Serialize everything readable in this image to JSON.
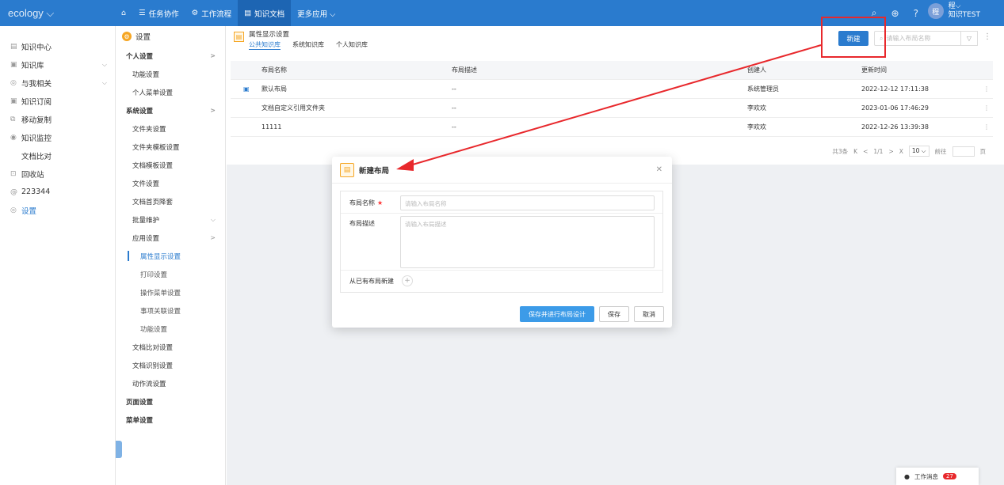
{
  "topbar": {
    "brand": "ecology ⌵",
    "home_icon": "home-icon",
    "nav": [
      {
        "icon": "☰",
        "label": "任务协作"
      },
      {
        "icon": "⚙",
        "label": "工作流程"
      },
      {
        "icon": "▤",
        "label": "知识文档"
      },
      {
        "icon": "",
        "label": "更多应用 ⌵"
      }
    ],
    "user_avatar": "程",
    "user_name": "程⌵",
    "user_sub": "知识TEST"
  },
  "leftnav": [
    {
      "icon": "▤",
      "label": "知识中心",
      "chev": ""
    },
    {
      "icon": "▣",
      "label": "知识库",
      "chev": "⌵"
    },
    {
      "icon": "◎",
      "label": "与我相关",
      "chev": "⌵"
    },
    {
      "icon": "▣",
      "label": "知识订阅",
      "chev": ""
    },
    {
      "icon": "⧉",
      "label": "移动复制",
      "chev": ""
    },
    {
      "icon": "◉",
      "label": "知识监控",
      "chev": ""
    },
    {
      "icon": "",
      "label": "文档比对",
      "chev": ""
    },
    {
      "icon": "⊡",
      "label": "回收站",
      "chev": ""
    },
    {
      "icon": "@",
      "label": "223344",
      "chev": ""
    },
    {
      "icon": "◎",
      "label": "设置",
      "chev": ""
    }
  ],
  "subnav": {
    "title": "设置",
    "items": [
      {
        "level": 0,
        "label": "个人设置",
        "chev": ">"
      },
      {
        "level": 1,
        "label": "功能设置",
        "chev": ""
      },
      {
        "level": 1,
        "label": "个人菜单设置",
        "chev": ""
      },
      {
        "level": 0,
        "label": "系统设置",
        "chev": ">"
      },
      {
        "level": 1,
        "label": "文件夹设置",
        "chev": ""
      },
      {
        "level": 1,
        "label": "文件夹模板设置",
        "chev": ""
      },
      {
        "level": 1,
        "label": "文档模板设置",
        "chev": ""
      },
      {
        "level": 1,
        "label": "文件设置",
        "chev": ""
      },
      {
        "level": 1,
        "label": "文档首页降套",
        "chev": ""
      },
      {
        "level": 1,
        "label": "批量维护",
        "chev": "⌵"
      },
      {
        "level": 1,
        "label": "应用设置",
        "chev": ">"
      },
      {
        "level": 2,
        "label": "属性显示设置",
        "chev": "",
        "active": true
      },
      {
        "level": 2,
        "label": "打印设置",
        "chev": ""
      },
      {
        "level": 2,
        "label": "操作菜单设置",
        "chev": ""
      },
      {
        "level": 2,
        "label": "事项关联设置",
        "chev": ""
      },
      {
        "level": 2,
        "label": "功能设置",
        "chev": ""
      },
      {
        "level": 1,
        "label": "文档比对设置",
        "chev": ""
      },
      {
        "level": 1,
        "label": "文档识别设置",
        "chev": ""
      },
      {
        "level": 1,
        "label": "动作流设置",
        "chev": ""
      },
      {
        "level": 0,
        "label": "页面设置",
        "chev": ""
      },
      {
        "level": 0,
        "label": "菜单设置",
        "chev": ""
      }
    ]
  },
  "page": {
    "title": "属性显示设置",
    "tabs": [
      "公共知识库",
      "系统知识库",
      "个人知识库"
    ],
    "new_label": "新建",
    "search_placeholder": "请输入布局名称",
    "columns": [
      "布局名称",
      "布局描述",
      "创建人",
      "更新时间"
    ],
    "rows": [
      {
        "name": "默认布局",
        "desc": "--",
        "creator": "系统管理员",
        "time": "2022-12-12 17:11:38",
        "icon": true
      },
      {
        "name": "文档自定义引用文件夹",
        "desc": "--",
        "creator": "李欢欢",
        "time": "2023-01-06 17:46:29",
        "icon": false
      },
      {
        "name": "11111",
        "desc": "--",
        "creator": "李欢欢",
        "time": "2022-12-26 13:39:38",
        "icon": false
      }
    ],
    "pager": {
      "total": "共3条",
      "first": "K",
      "prev": "<",
      "page": "1/1",
      "next": ">",
      "last": "X",
      "size": "10 ⌵",
      "goto": "前往",
      "unit": "页"
    }
  },
  "modal": {
    "title": "新建布局",
    "name_label": "布局名称",
    "required_mark": "★",
    "name_placeholder": "请输入布局名称",
    "desc_label": "布局描述",
    "desc_placeholder": "请输入布局描述",
    "from_label": "从已有布局新建",
    "btn_save_design": "保存并进行布局设计",
    "btn_save": "保存",
    "btn_cancel": "取消"
  },
  "notice": {
    "label": "工作消息",
    "count": "27"
  },
  "colors": {
    "accent": "#2a7bce",
    "highlight": "#e8282c"
  }
}
